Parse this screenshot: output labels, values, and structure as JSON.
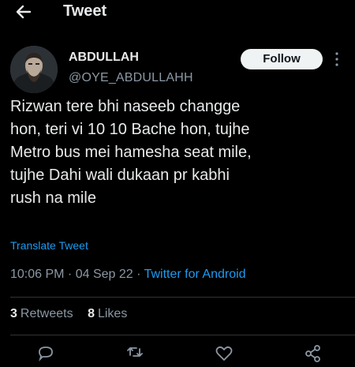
{
  "header": {
    "title": "Tweet",
    "back_icon": "back-arrow-icon"
  },
  "author": {
    "display_name": "ABDULLAH",
    "handle": "@OYE_ABDULLAHH",
    "follow_label": "Follow"
  },
  "tweet": {
    "lines": [
      "Rizwan tere bhi naseeb changge",
      "hon, teri vi 10 10 Bache hon, tujhe",
      "Metro bus mei hamesha seat mile,",
      "tujhe Dahi wali dukaan pr kabhi",
      "rush na mile"
    ],
    "translate_label": "Translate Tweet",
    "time": "10:06 PM",
    "separator": " · ",
    "date": "04 Sep 22",
    "source": "Twitter for Android"
  },
  "stats": {
    "retweets_count": "3",
    "retweets_label": "Retweets",
    "likes_count": "8",
    "likes_label": "Likes"
  },
  "actions": [
    "reply-icon",
    "retweet-icon",
    "like-icon",
    "share-icon"
  ],
  "colors": {
    "background": "#000000",
    "text": "#e7e9ea",
    "secondary": "#8b98a5",
    "accent": "#1d9bf0",
    "follow_bg": "#eff3f4"
  }
}
